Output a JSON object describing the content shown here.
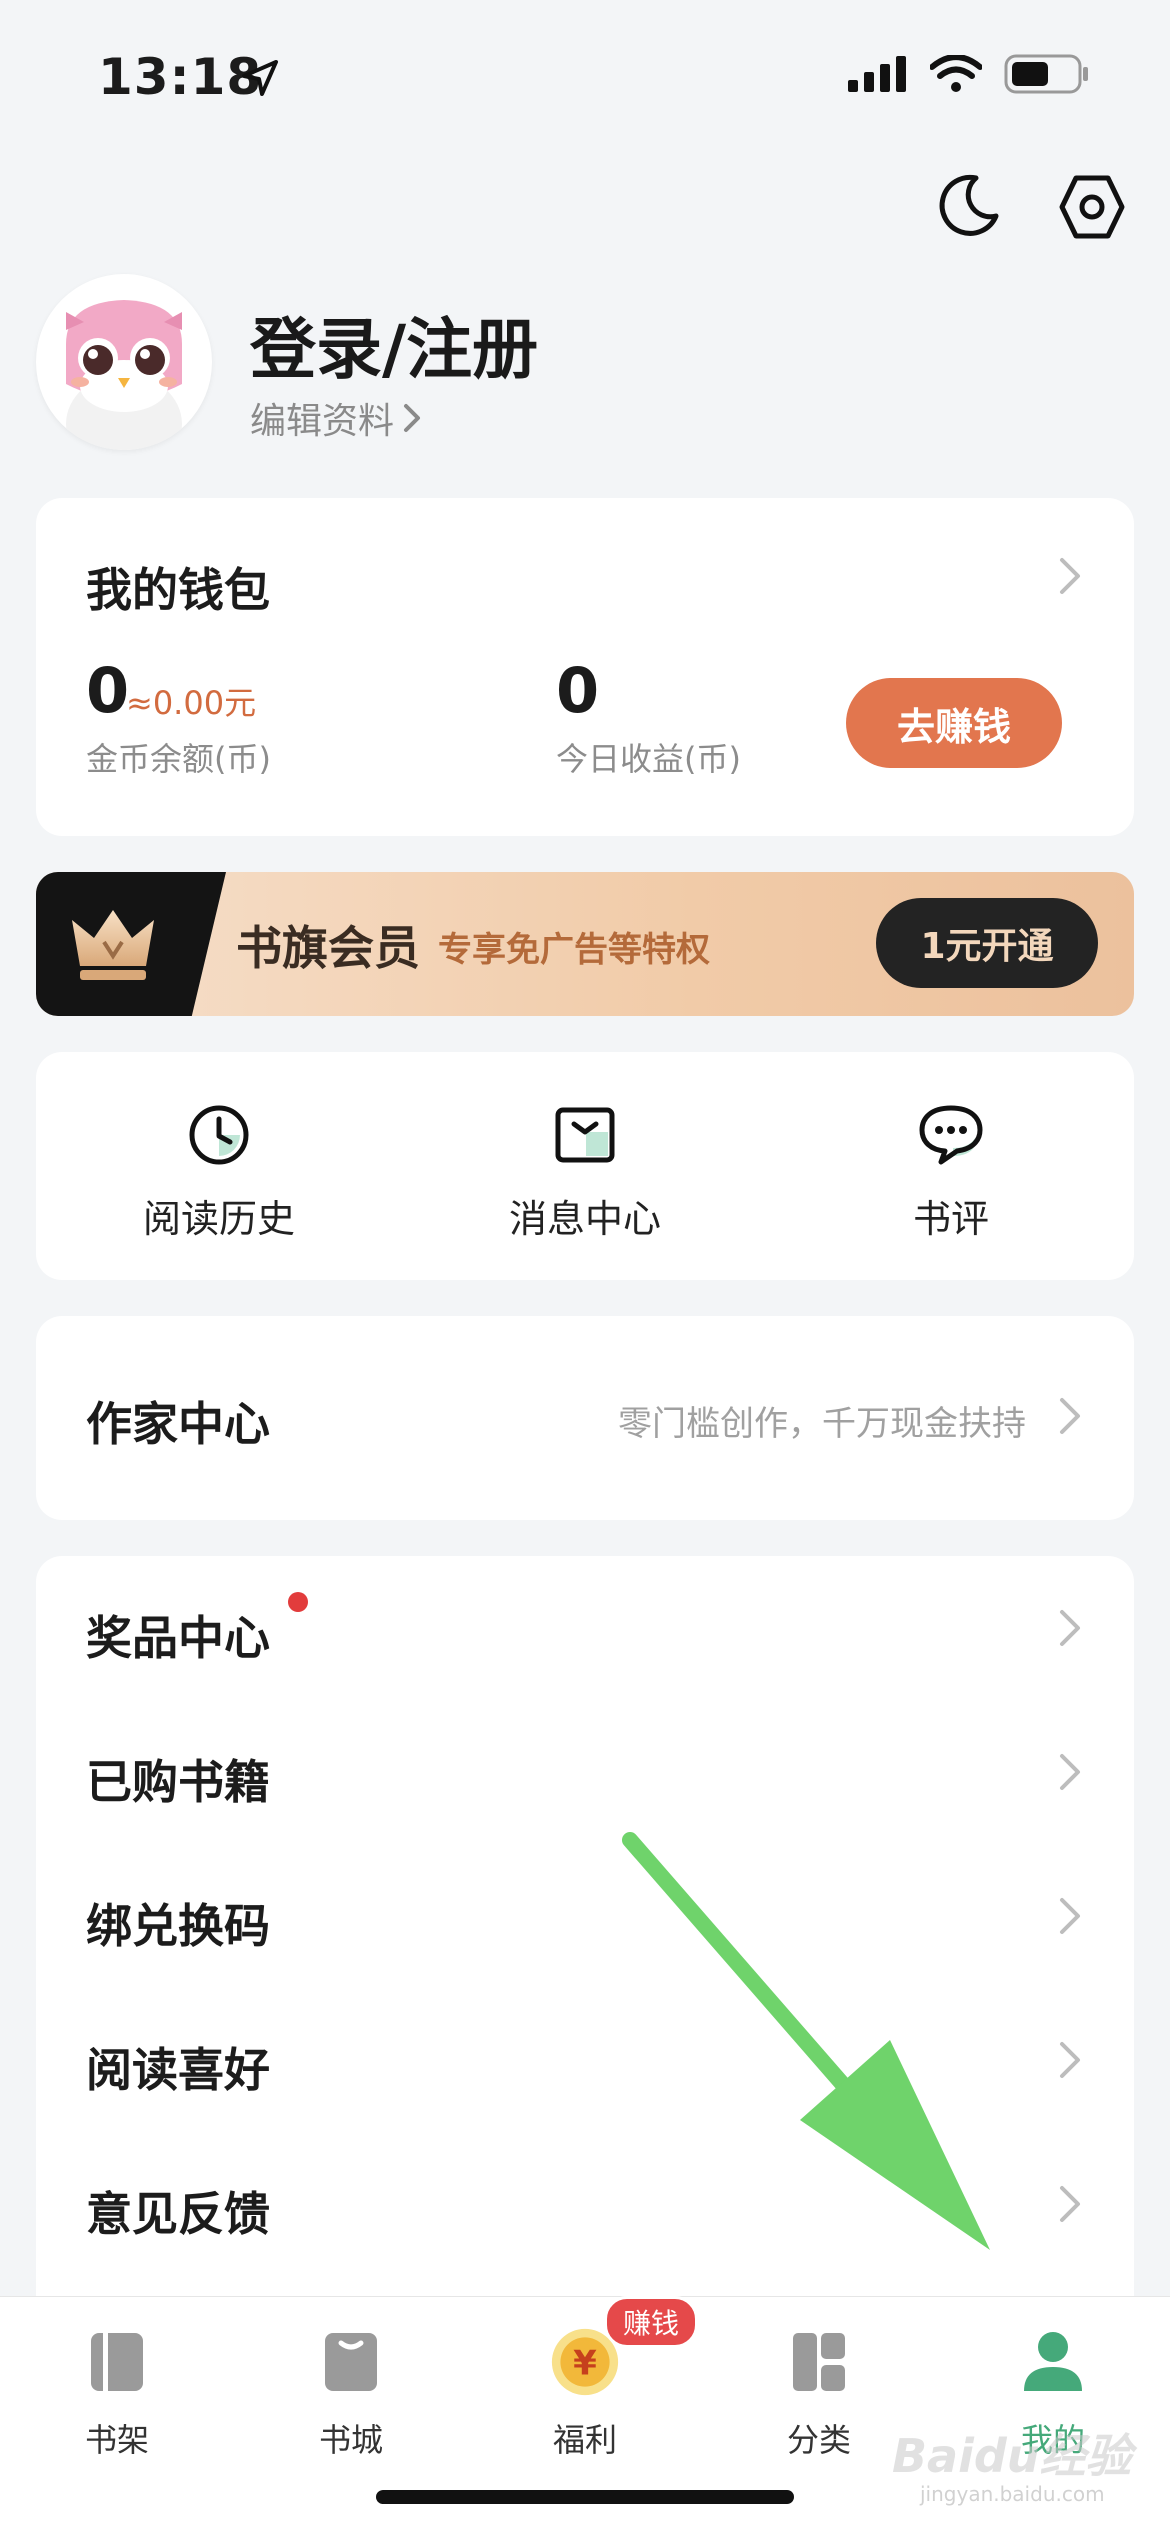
{
  "status_bar": {
    "time": "13:18"
  },
  "profile": {
    "title": "登录/注册",
    "edit_label": "编辑资料"
  },
  "wallet": {
    "title": "我的钱包",
    "coin_balance": "0",
    "coin_approx": "≈0.00元",
    "coin_label": "金币余额(币)",
    "today_value": "0",
    "today_label": "今日收益(币)",
    "earn_button": "去赚钱"
  },
  "vip": {
    "title": "书旗会员",
    "subtitle": "专享免广告等特权",
    "button": "1元开通"
  },
  "shortcuts": [
    {
      "label": "阅读历史",
      "icon": "clock-icon"
    },
    {
      "label": "消息中心",
      "icon": "message-box-icon"
    },
    {
      "label": "书评",
      "icon": "chat-bubble-icon"
    }
  ],
  "writer": {
    "title": "作家中心",
    "subtitle": "零门槛创作，千万现金扶持"
  },
  "menu": [
    {
      "label": "奖品中心",
      "dot": true
    },
    {
      "label": "已购书籍"
    },
    {
      "label": "绑兑换码"
    },
    {
      "label": "阅读喜好"
    },
    {
      "label": "意见反馈"
    }
  ],
  "bottom_nav": {
    "items": [
      {
        "label": "书架",
        "icon": "bookshelf-icon"
      },
      {
        "label": "书城",
        "icon": "bookstore-icon"
      },
      {
        "label": "福利",
        "icon": "coin-icon"
      },
      {
        "label": "分类",
        "icon": "category-icon"
      },
      {
        "label": "我的",
        "icon": "profile-icon"
      }
    ],
    "active_index": 4,
    "earn_badge": "赚钱"
  },
  "watermark": {
    "brand": "Baidu经验",
    "domain": "jingyan.baidu.com"
  },
  "colors": {
    "accent_orange": "#e2764e",
    "active_green": "#45a97a",
    "badge_red": "#e5494a",
    "arrow_green": "#6fd36b"
  }
}
